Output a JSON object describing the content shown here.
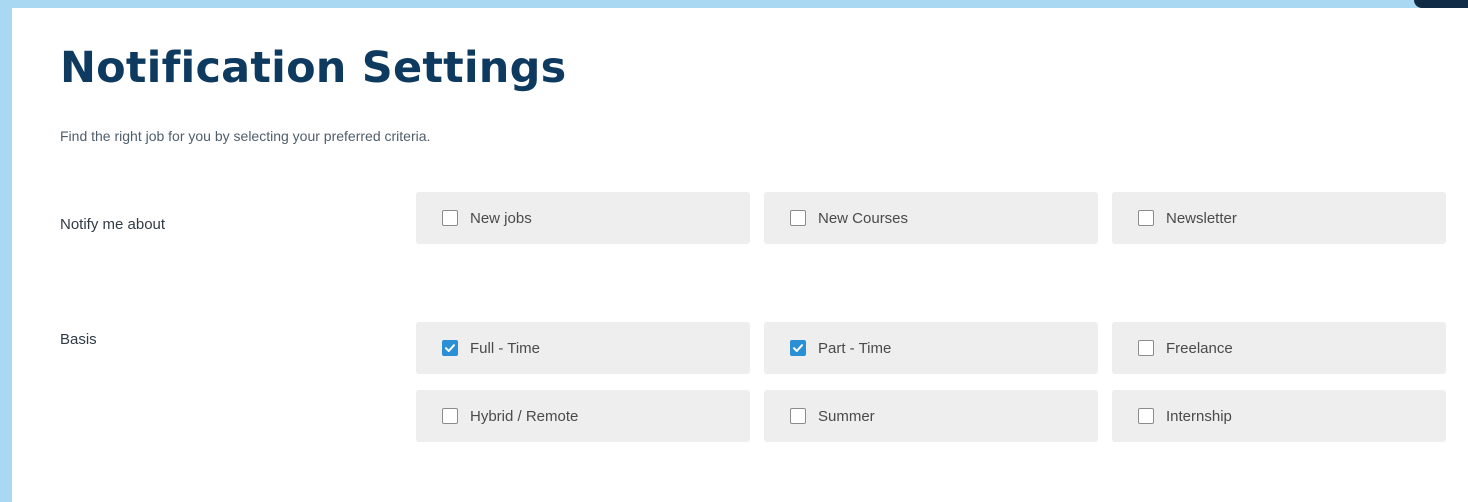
{
  "header": {
    "title": "Notification Settings",
    "subtitle": "Find the right job for you by selecting your preferred criteria."
  },
  "notify": {
    "label": "Notify me about",
    "options": [
      {
        "label": "New jobs",
        "checked": false
      },
      {
        "label": "New Courses",
        "checked": false
      },
      {
        "label": "Newsletter",
        "checked": false
      }
    ]
  },
  "basis": {
    "label": "Basis",
    "options": [
      {
        "label": "Full - Time",
        "checked": true
      },
      {
        "label": "Part - Time",
        "checked": true
      },
      {
        "label": "Freelance",
        "checked": false
      },
      {
        "label": "Hybrid / Remote",
        "checked": false
      },
      {
        "label": "Summer",
        "checked": false
      },
      {
        "label": "Internship",
        "checked": false
      }
    ]
  },
  "colors": {
    "title": "#0e3a60",
    "accent": "#2b8fd6",
    "option_bg": "#eeeeee",
    "frame": "#a9d9f2"
  },
  "icons": {
    "checkmark": "check-icon"
  }
}
